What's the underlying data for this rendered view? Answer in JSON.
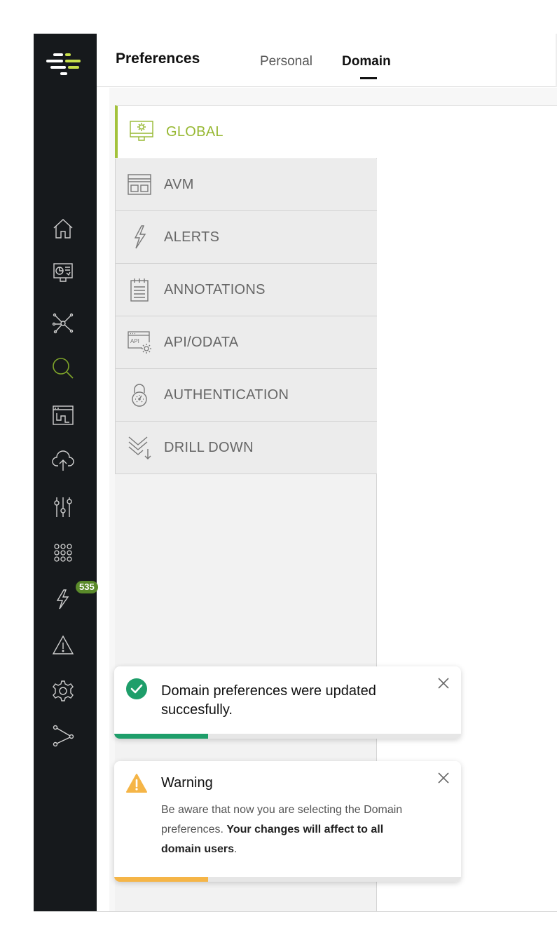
{
  "header": {
    "title": "Preferences",
    "tabs": [
      {
        "label": "Personal",
        "active": false
      },
      {
        "label": "Domain",
        "active": true
      }
    ]
  },
  "sidebar": {
    "icons": [
      "home-icon",
      "dashboard-icon",
      "topology-icon",
      "search-icon",
      "layout-icon",
      "cloud-upload-icon",
      "sliders-icon",
      "grid-dots-icon",
      "alerts-icon",
      "warning-icon",
      "settings-icon",
      "share-icon"
    ],
    "alerts_badge": "535",
    "active_color": "#7fa52a"
  },
  "menu": {
    "items": [
      {
        "label": "GLOBAL",
        "icon": "monitor-gear-icon",
        "active": true
      },
      {
        "label": "AVM",
        "icon": "window-layout-icon",
        "active": false
      },
      {
        "label": "ALERTS",
        "icon": "lightning-icon",
        "active": false
      },
      {
        "label": "ANNOTATIONS",
        "icon": "notepad-icon",
        "active": false
      },
      {
        "label": "API/ODATA",
        "icon": "api-gear-icon",
        "active": false
      },
      {
        "label": "AUTHENTICATION",
        "icon": "lock-icon",
        "active": false
      },
      {
        "label": "DRILL DOWN",
        "icon": "drill-down-icon",
        "active": false
      }
    ],
    "accent": "#a3c23c"
  },
  "toasts": {
    "success": {
      "message": "Domain preferences were updated succesfully.",
      "color": "#1e9e6a",
      "progress": 0.27
    },
    "warning": {
      "title": "Warning",
      "message_plain": "Be aware that now you are selecting the Domain preferences.",
      "message_bold": "Your changes will affect to all domain users",
      "message_end": ".",
      "color": "#f5b547",
      "progress": 0.27
    }
  }
}
